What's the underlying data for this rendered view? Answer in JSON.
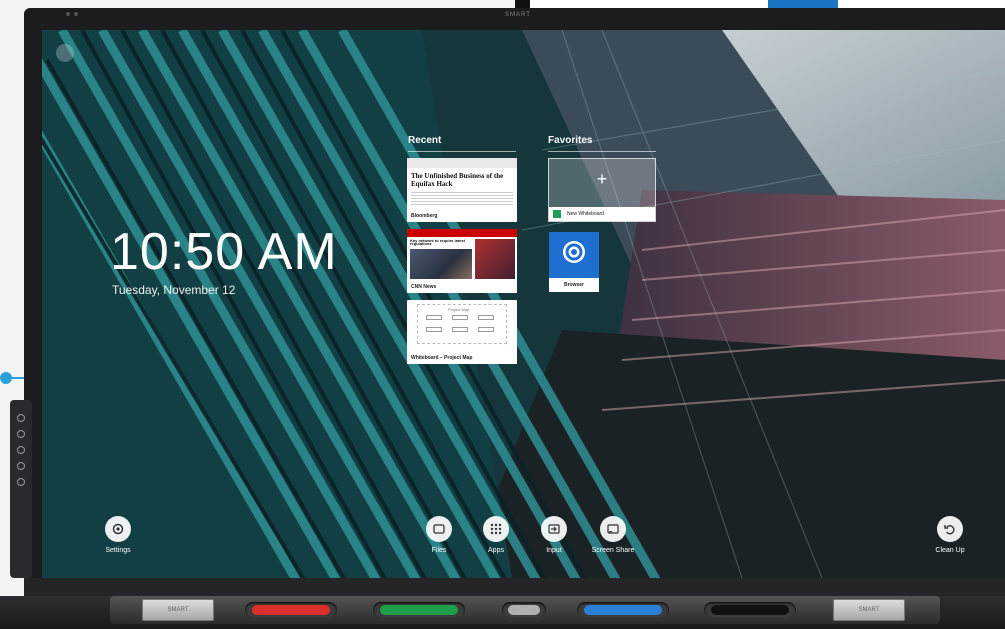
{
  "device": {
    "brand_top": "SMART",
    "brand_tray_left": "SMART",
    "brand_tray_right": "SMART",
    "accent": "#2aa0d8"
  },
  "home": {
    "time": "10:50 AM",
    "date": "Tuesday, November 12"
  },
  "recent": {
    "title": "Recent",
    "items": [
      {
        "label": "Bloomberg",
        "headline": "The Unfinished Business of the Equifax Hack"
      },
      {
        "label": "CNN News",
        "headline": "Key network to require latest regulations"
      },
      {
        "label": "Whiteboard – Project Map",
        "headline": "Project Map"
      }
    ]
  },
  "favorites": {
    "title": "Favorites",
    "items": [
      {
        "label": "New Whiteboard",
        "icon": "plus-icon"
      },
      {
        "label": "Browser",
        "icon": "chrome-icon"
      }
    ]
  },
  "dock": {
    "settings": "Settings",
    "files": "Files",
    "apps": "Apps",
    "input": "Input",
    "screen_share": "Screen Share",
    "clean_up": "Clean Up"
  },
  "pens": {
    "red": "#d9302c",
    "green": "#1f9e4a",
    "blue": "#2a7fd6",
    "black": "#111111"
  }
}
